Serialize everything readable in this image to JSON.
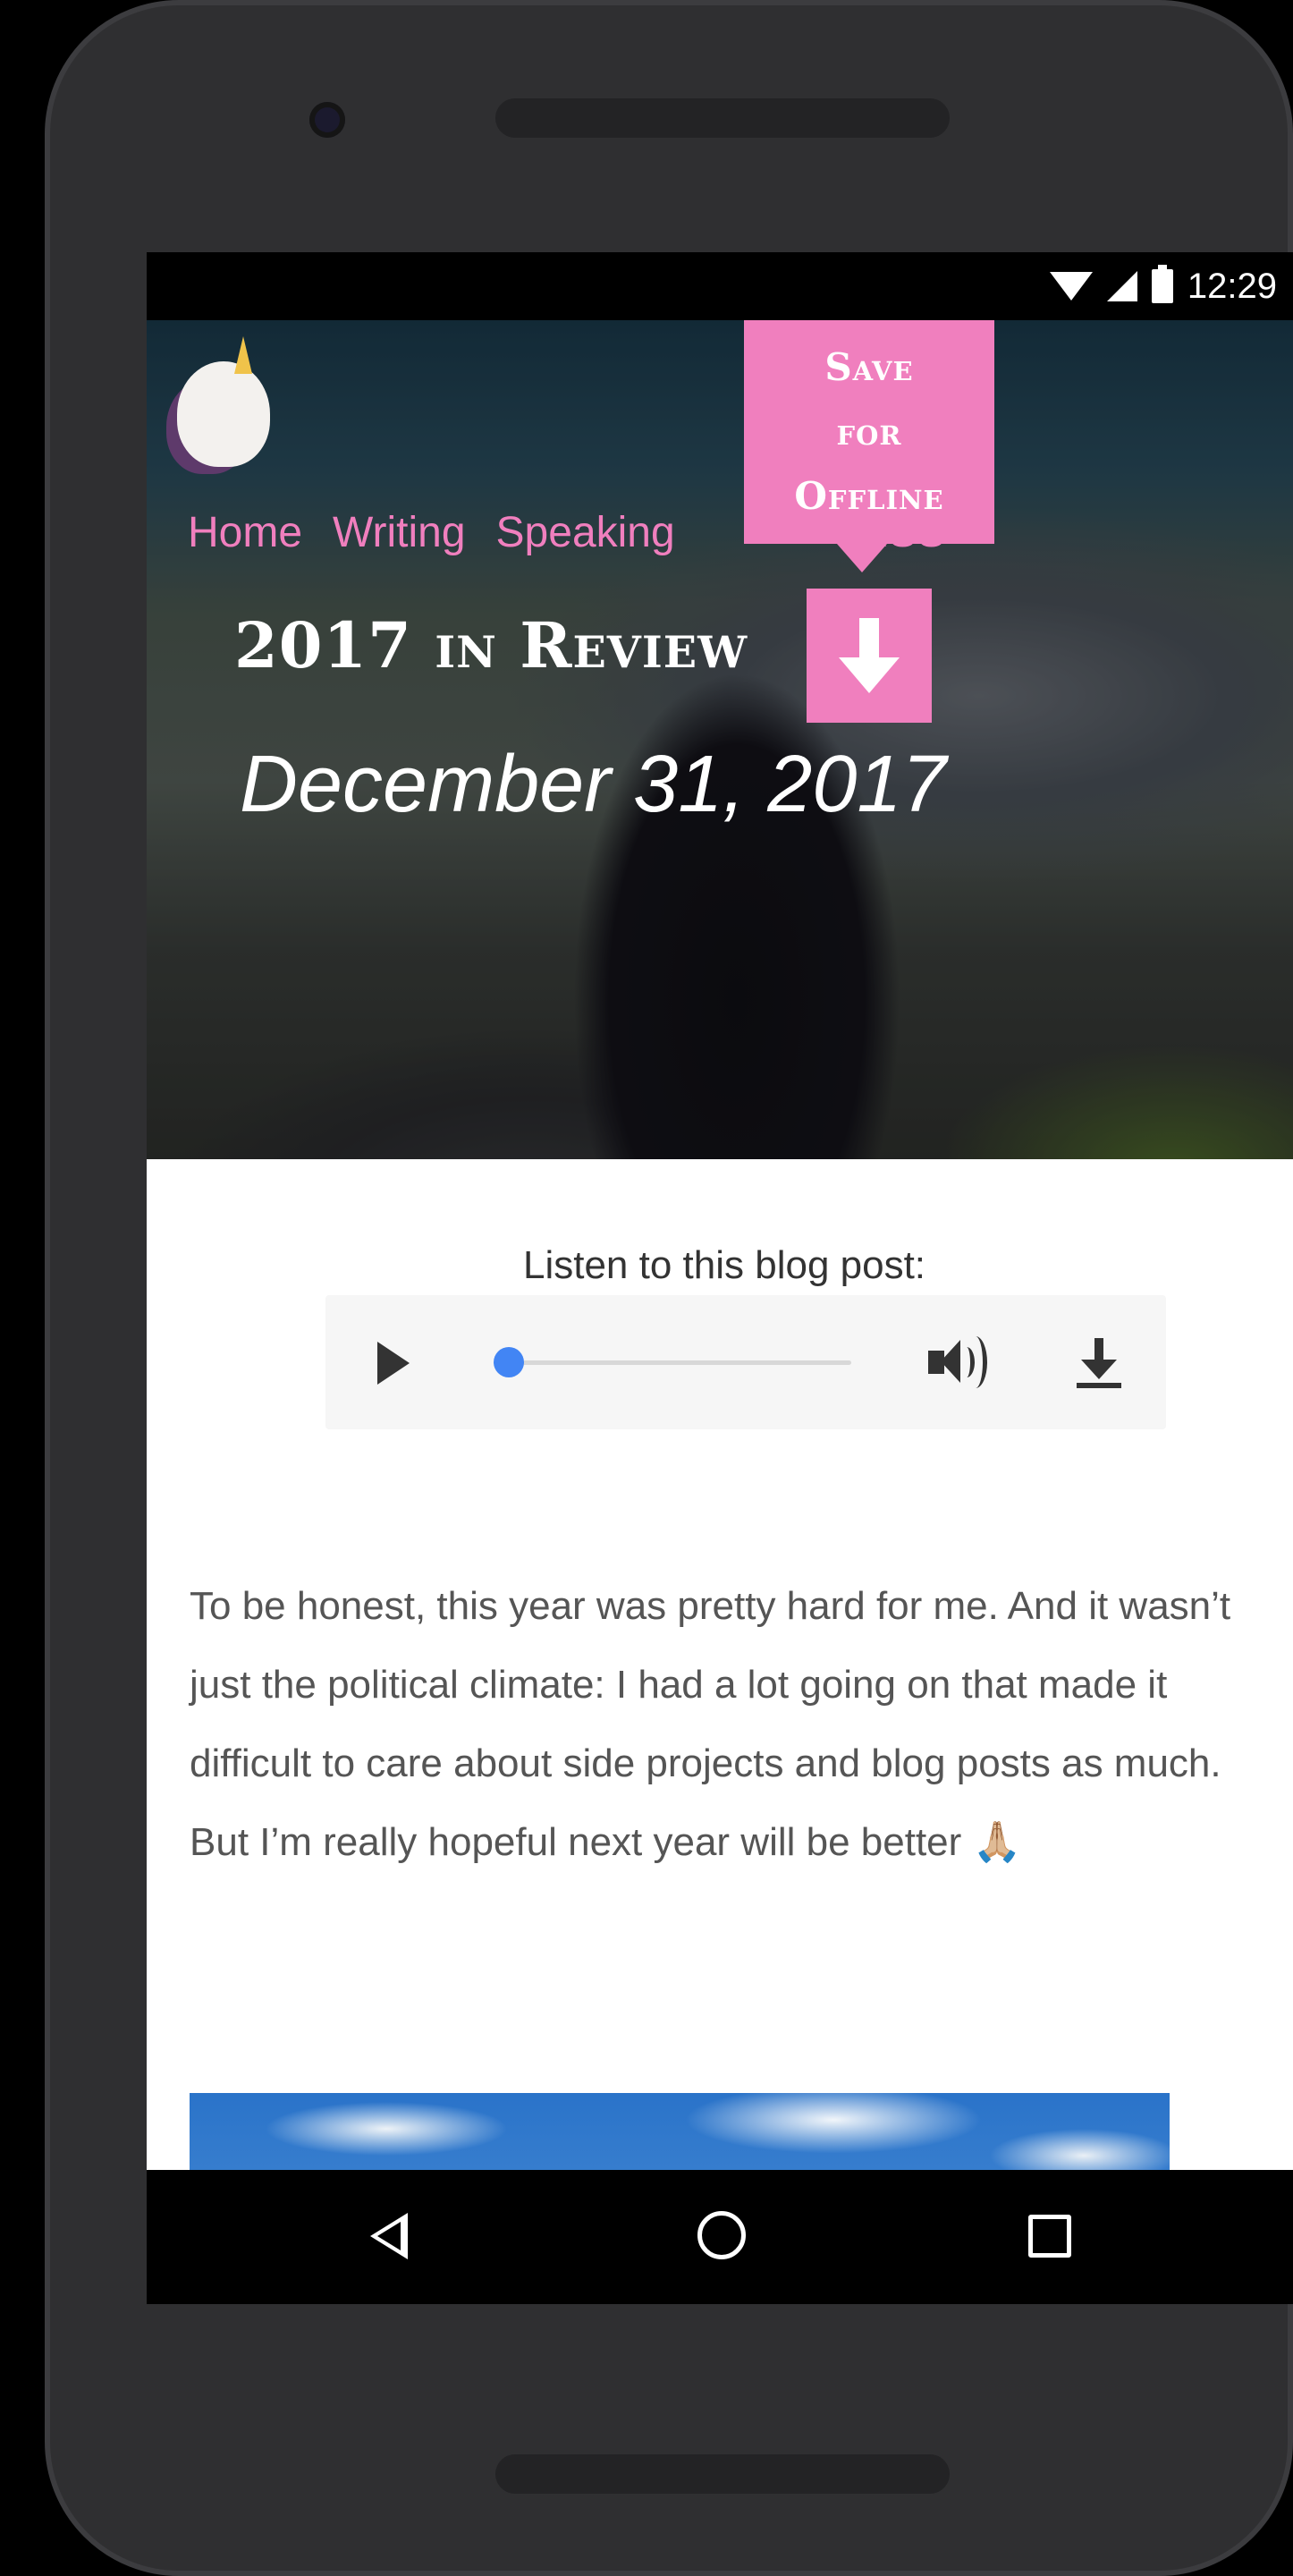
{
  "status_bar": {
    "time": "12:29",
    "icons": [
      "wifi-icon",
      "signal-icon",
      "battery-icon"
    ]
  },
  "site": {
    "logo": "unicorn-logo",
    "nav": [
      {
        "label": "Home"
      },
      {
        "label": "Writing"
      },
      {
        "label": "Speaking"
      },
      {
        "label": "RSS"
      }
    ],
    "save_offline": {
      "line1": "Save",
      "line2": "for",
      "line3": "Offline",
      "icon": "download-arrow-icon"
    }
  },
  "post": {
    "title": "2017 in Review",
    "date": "December 31, 2017",
    "audio": {
      "label": "Listen to this blog post:",
      "icons": [
        "play-icon",
        "volume-icon",
        "download-icon"
      ]
    },
    "body": "To be honest, this year was pretty hard for me. And it wasn’t just the political climate: I had a lot going on that made it difficult to care about side projects and blog posts as much. But I’m really hopeful next year will be better 🙏🏼"
  },
  "android_nav": {
    "icons": [
      "back-icon",
      "home-icon",
      "recents-icon"
    ]
  },
  "colors": {
    "accent_pink": "#f07fbe",
    "progress_blue": "#4285f4",
    "text_gray": "#555555"
  }
}
